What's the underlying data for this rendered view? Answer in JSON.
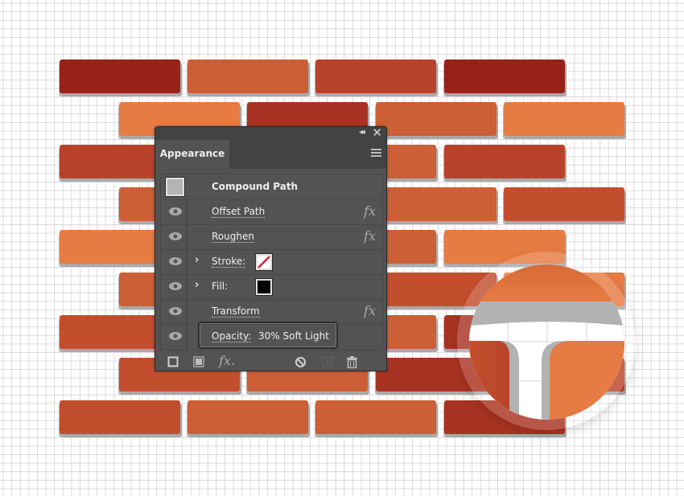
{
  "canvas": {
    "background": "#ffffff",
    "grid_color": "#d9d9d9"
  },
  "bricks": {
    "colors": {
      "dark_red": "#98221a",
      "red": "#a93322",
      "brick": "#b9432a",
      "rust": "#c34e2e",
      "orange": "#cc5f35",
      "light_orange": "#e67b43"
    },
    "shadow_color": "#a9a9a9"
  },
  "panel": {
    "tab_label": "Appearance",
    "object_type": "Compound Path",
    "rows": [
      {
        "label": "Offset Path",
        "has_fx": true,
        "visible": true
      },
      {
        "label": "Roughen",
        "has_fx": true,
        "visible": true
      },
      {
        "label": "Stroke:",
        "has_chevron": true,
        "swatch": "none",
        "visible": true
      },
      {
        "label": "Fill:",
        "has_chevron": true,
        "swatch": "#000000",
        "visible": true
      },
      {
        "label": "Transform",
        "has_fx": true,
        "visible": true
      },
      {
        "label": "Opacity:",
        "value": "30% Soft Light",
        "visible": true,
        "highlighted": true
      }
    ],
    "fx_symbol": "fx",
    "footer": {
      "add_stroke": "add-new-stroke",
      "add_fill": "add-new-fill",
      "add_effect": "fx.",
      "clear": "clear-appearance",
      "duplicate": "duplicate-selected-item",
      "delete": "delete-selected-item"
    }
  },
  "magnifier": {
    "subject": "zoomed brick corner with white rough gap"
  }
}
